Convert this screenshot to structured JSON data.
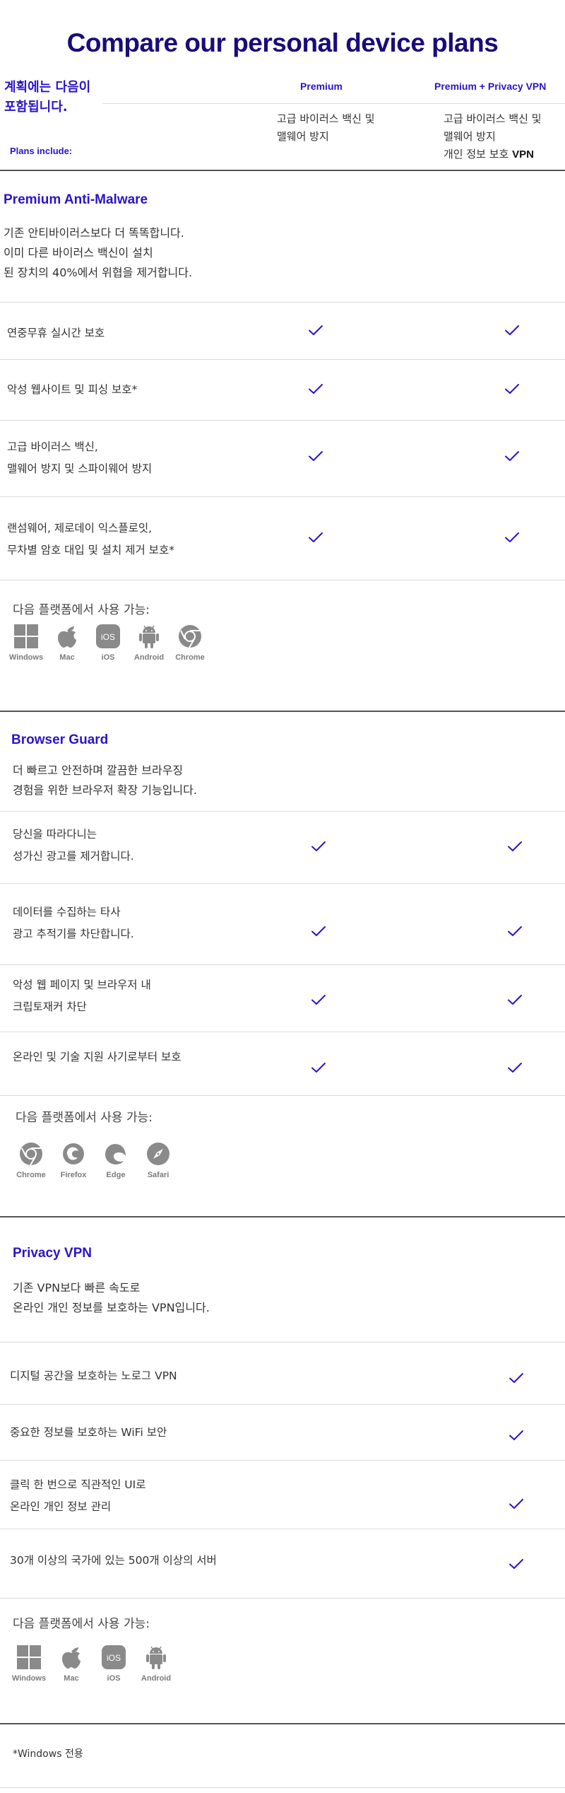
{
  "title": "Compare our personal device plans",
  "header": {
    "plans_label": "계획에는 다음이 포함됩니다.",
    "plans_label_line1": "계획에는 다음이",
    "plans_label_line2": "포함됩니다.",
    "plans_include": "Plans include:",
    "col1": {
      "name": "Premium",
      "desc_line1": "고급 바이러스 백신 및",
      "desc_line2": "맬웨어 방지"
    },
    "col2": {
      "name": "Premium + Privacy VPN",
      "desc_line1": "고급 바이러스 백신 및",
      "desc_line2": "맬웨어 방지",
      "desc_line3_text": "개인 정보 보호 ",
      "desc_line3_bold": "VPN"
    }
  },
  "sections": [
    {
      "title": "Premium Anti-Malware",
      "desc": [
        "기존 안티바이러스보다 더 똑똑합니다.",
        "이미 다른 바이러스 백신이 설치",
        "된 장치의 40%에서 위협을 제거합니다."
      ],
      "features": [
        {
          "lines": [
            "연중무휴 실시간 보호"
          ],
          "premium": true,
          "vpn": true
        },
        {
          "lines": [
            "악성 웹사이트 및 피싱 보호*"
          ],
          "premium": true,
          "vpn": true
        },
        {
          "lines": [
            "고급 바이러스 백신,",
            "맬웨어 방지 및 스파이웨어 방지"
          ],
          "premium": true,
          "vpn": true
        },
        {
          "lines": [
            "랜섬웨어, 제로데이 익스플로잇,",
            "무차별 암호 대입 및 설치 제거 보호*"
          ],
          "premium": true,
          "vpn": true
        }
      ],
      "available_label": "다음 플랫폼에서 사용 가능:",
      "platforms": [
        "Windows",
        "Mac",
        "iOS",
        "Android",
        "Chrome"
      ]
    },
    {
      "title": "Browser Guard",
      "desc": [
        "더 빠르고 안전하며 깔끔한 브라우징",
        "경험을 위한 브라우저 확장 기능입니다."
      ],
      "features": [
        {
          "lines": [
            "당신을 따라다니는",
            "성가신 광고를 제거합니다."
          ],
          "premium": true,
          "vpn": true
        },
        {
          "lines": [
            "데이터를 수집하는 타사",
            "광고 추적기를 차단합니다."
          ],
          "premium": true,
          "vpn": true
        },
        {
          "lines": [
            "악성 웹 페이지 및 브라우저 내",
            "크립토재커 차단"
          ],
          "premium": true,
          "vpn": true
        },
        {
          "lines": [
            "온라인 및 기술 지원 사기로부터 보호"
          ],
          "premium": true,
          "vpn": true
        }
      ],
      "available_label": "다음 플랫폼에서 사용 가능:",
      "platforms": [
        "Chrome",
        "Firefox",
        "Edge",
        "Safari"
      ]
    },
    {
      "title": "Privacy VPN",
      "desc": [
        "기존 VPN보다 빠른 속도로",
        "온라인 개인 정보를 보호하는 VPN입니다."
      ],
      "features": [
        {
          "lines": [
            "디지털 공간을 보호하는 노로그 VPN"
          ],
          "premium": false,
          "vpn": true
        },
        {
          "lines": [
            "중요한 정보를 보호하는 WiFi 보안"
          ],
          "premium": false,
          "vpn": true
        },
        {
          "lines": [
            "클릭 한 번으로 직관적인 UI로",
            "온라인 개인 정보 관리"
          ],
          "premium": false,
          "vpn": true
        },
        {
          "lines": [
            "30개 이상의 국가에 있는 500개 이상의 서버"
          ],
          "premium": false,
          "vpn": true
        }
      ],
      "available_label": "다음 플랫폼에서 사용 가능:",
      "platforms": [
        "Windows",
        "Mac",
        "iOS",
        "Android"
      ]
    }
  ],
  "footnote": "*Windows 전용",
  "colors": {
    "title": "#1a0b7a",
    "accent": "#2a15c9",
    "check": "#2a15c9",
    "icon": "#8a8a8a"
  },
  "icons": {
    "check": "check-icon",
    "Windows": "windows-icon",
    "Mac": "apple-icon",
    "iOS": "ios-icon",
    "Android": "android-icon",
    "Chrome": "chrome-icon",
    "Firefox": "firefox-icon",
    "Edge": "edge-icon",
    "Safari": "safari-icon"
  }
}
